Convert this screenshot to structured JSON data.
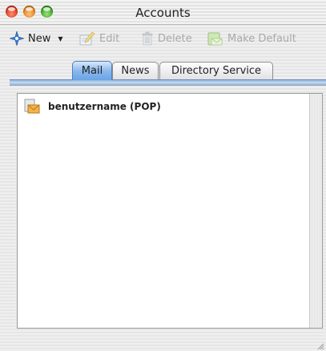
{
  "window": {
    "title": "Accounts"
  },
  "toolbar": {
    "new_label": "New",
    "edit_label": "Edit",
    "delete_label": "Delete",
    "make_default_label": "Make Default"
  },
  "tabs": [
    {
      "label": "Mail",
      "selected": true
    },
    {
      "label": "News",
      "selected": false
    },
    {
      "label": "Directory Service",
      "selected": false
    }
  ],
  "accounts": [
    {
      "name": "benutzername (POP)",
      "icon": "mail-account-icon"
    }
  ],
  "colors": {
    "close": "#d4301a",
    "minimize": "#e07b10",
    "zoom": "#2e9e1c",
    "tab_active": "#6aa3e6"
  }
}
